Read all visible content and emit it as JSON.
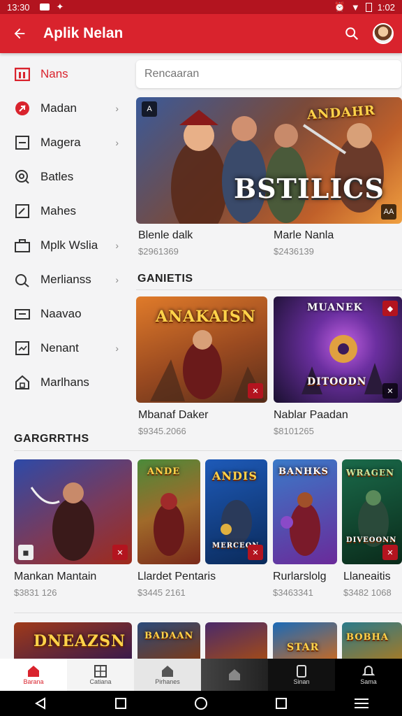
{
  "status": {
    "time": "13:30",
    "right_time": "1:02"
  },
  "appbar": {
    "title": "Aplik Nelan"
  },
  "search": {
    "placeholder": "Rencaaran"
  },
  "sidebar": {
    "items": [
      {
        "label": "Nans",
        "icon": "calendar-icon",
        "active": true
      },
      {
        "label": "Madan",
        "icon": "game-icon",
        "chevron": true
      },
      {
        "label": "Magera",
        "icon": "square-icon",
        "chevron": true
      },
      {
        "label": "Batles",
        "icon": "search-circle-icon"
      },
      {
        "label": "Mahes",
        "icon": "edit-icon"
      },
      {
        "label": "Mplk Wslia",
        "icon": "bag-icon",
        "chevron": true
      },
      {
        "label": "Merlianss",
        "icon": "search-icon",
        "chevron": true
      },
      {
        "label": "Naavao",
        "icon": "message-icon"
      },
      {
        "label": "Nenant",
        "icon": "chart-icon",
        "chevron": true
      },
      {
        "label": "Marlhans",
        "icon": "home-icon"
      }
    ]
  },
  "hero": {
    "title_art": "BSTILICS",
    "top_art": "ANDAHR",
    "badge": "A",
    "corner": "AA",
    "items": [
      {
        "name": "Blenle dalk",
        "price": "$2961369"
      },
      {
        "name": "Marle Nanla",
        "price": "$2436139"
      }
    ]
  },
  "section1": {
    "title": "GANIETIS",
    "cards": [
      {
        "art": "ANAKAISN",
        "name": "Mbanaf Daker",
        "price": "$9345.2066",
        "colors": [
          "#e07b2a",
          "#5a2e1a"
        ]
      },
      {
        "art": "DITOODN",
        "name": "Nablar Paadan",
        "price": "$8101265",
        "colors": [
          "#6b2fa0",
          "#1a1030"
        ]
      }
    ]
  },
  "section2": {
    "title": "GARGRRTHS",
    "cards": [
      {
        "art": "",
        "name": "Mankan Mantain",
        "price": "$3831 126",
        "colors": [
          "#2d4aa8",
          "#a02a1a"
        ]
      },
      {
        "art": "ANDE",
        "name": "Llardet Pentaris",
        "price": "$3445 2161",
        "colors": [
          "#4a8a3a",
          "#7a2a1a"
        ]
      },
      {
        "art": "ANDIS",
        "name": "",
        "price": "",
        "colors": [
          "#1e5ab8",
          "#0a2a5a"
        ]
      },
      {
        "art": "BANHKS",
        "name": "Rurlarslolg",
        "price": "$3463341",
        "colors": [
          "#3a7ac8",
          "#6a2a9a"
        ]
      },
      {
        "art": "WRAGEN",
        "name": "Llaneaitis",
        "price": "$3482 1068",
        "colors": [
          "#1a6a4a",
          "#0a2a1a"
        ]
      }
    ]
  },
  "section3": {
    "cards": [
      {
        "art": "DNEAZSN",
        "colors": [
          "#a03a1a",
          "#3a1a4a"
        ]
      },
      {
        "art": "BADAAN",
        "colors": [
          "#2a4a7a",
          "#7a3a1a"
        ]
      },
      {
        "art": "",
        "colors": [
          "#4a2a6a",
          "#a04a1a"
        ]
      },
      {
        "art": "STAR",
        "colors": [
          "#1a6ab8",
          "#c06a2a"
        ]
      },
      {
        "art": "BOBHA",
        "colors": [
          "#2a7a8a",
          "#a07a2a"
        ]
      }
    ]
  },
  "mid_items": [
    {
      "name": "Mankan Mantain",
      "price": "$3831 126"
    },
    {
      "name": "Llardet Pentaris",
      "price": "$3445 2161"
    },
    {
      "name": "Rurlarslolg",
      "price": "$3463341"
    },
    {
      "name": "Llaneaitis",
      "price": "$3482 1068"
    }
  ],
  "bottomnav": {
    "items": [
      {
        "label": "Barana",
        "icon": "home-icon",
        "active": true
      },
      {
        "label": "Catiana",
        "icon": "grid-icon"
      },
      {
        "label": "Pirhanes",
        "icon": "house-icon"
      },
      {
        "label": "",
        "icon": "house-icon"
      },
      {
        "label": "Sinan",
        "icon": "phone-icon"
      },
      {
        "label": "Sama",
        "icon": "bell-icon"
      }
    ]
  },
  "colors": {
    "accent": "#d9232d",
    "statusbar": "#b3141f"
  }
}
